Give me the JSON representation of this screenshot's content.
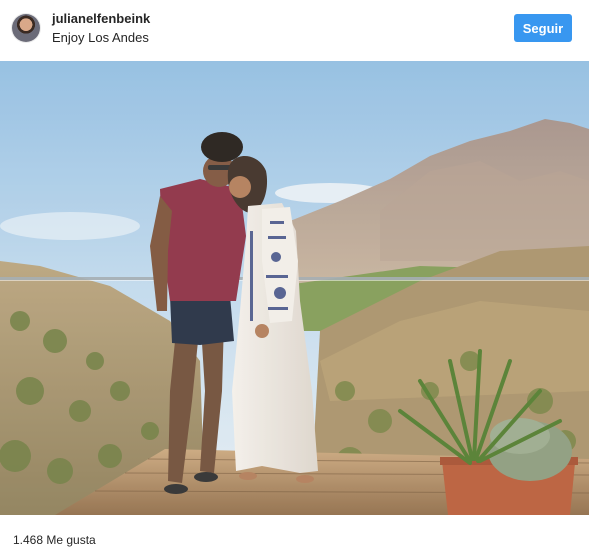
{
  "post": {
    "username": "julianelfenbeink",
    "location": "Enjoy Los Andes",
    "follow_label": "Seguir",
    "likes_text": "1.468 Me gusta"
  },
  "colors": {
    "follow_button": "#3897f0",
    "text_primary": "#262626",
    "sky": "#a9cbe6"
  },
  "photo": {
    "subject": "couple-on-terrace-mountains",
    "icons": {
      "avatar": "avatar-icon"
    }
  }
}
